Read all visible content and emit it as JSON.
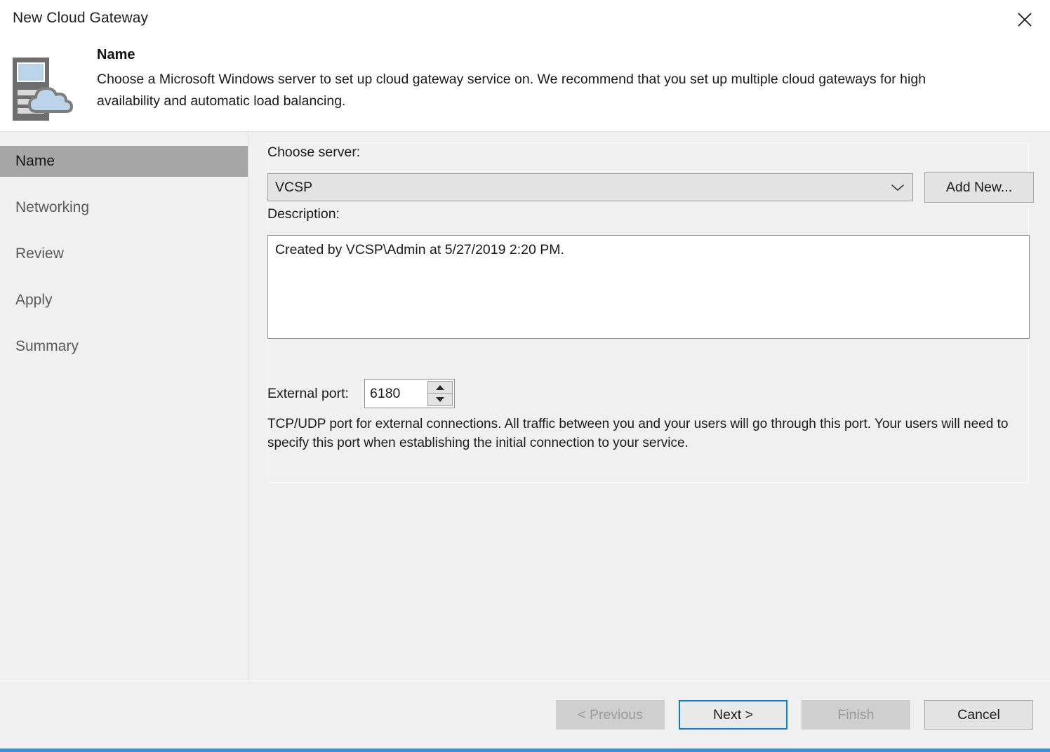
{
  "window": {
    "title": "New Cloud Gateway",
    "close_icon": "close-icon",
    "accent_color": "#3a8edb"
  },
  "header": {
    "icon": "cloud-gateway-server-icon",
    "heading": "Name",
    "description": "Choose a Microsoft Windows server to set up cloud gateway service on. We recommend that you set up multiple cloud gateways for high availability and automatic load balancing."
  },
  "sidebar": {
    "items": [
      {
        "label": "Name",
        "selected": true
      },
      {
        "label": "Networking",
        "selected": false
      },
      {
        "label": "Review",
        "selected": false
      },
      {
        "label": "Apply",
        "selected": false
      },
      {
        "label": "Summary",
        "selected": false
      }
    ],
    "selected_color": "#a6a6a6"
  },
  "form": {
    "choose_server_label": "Choose server:",
    "choose_server_value": "VCSP",
    "choose_server_arrow_icon": "chevron-down-icon",
    "add_new_label": "Add New...",
    "description_label": "Description:",
    "description_value": "Created by VCSP\\Admin at 5/27/2019 2:20 PM.",
    "external_port_label": "External port:",
    "external_port_value": "6180",
    "spin_up_icon": "spinner-up-arrow-icon",
    "spin_down_icon": "spinner-down-arrow-icon",
    "hint": "TCP/UDP port for external connections. All traffic between you and your users will go through this port. Your users will need to specify this port when establishing the initial connection to your service."
  },
  "footer": {
    "previous_label": "< Previous",
    "next_label": "Next >",
    "finish_label": "Finish",
    "cancel_label": "Cancel",
    "focus_color": "#0d7ad6"
  }
}
